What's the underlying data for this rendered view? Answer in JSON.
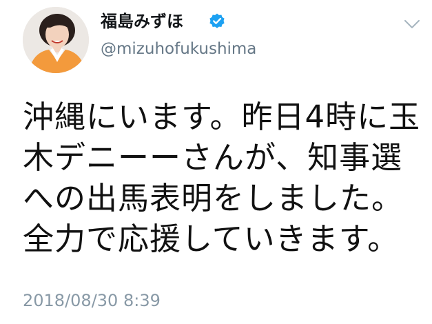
{
  "user": {
    "display_name": "福島みずほ",
    "handle": "@mizuhofukushima",
    "verified": true,
    "verified_color": "#1da1f2"
  },
  "tweet": {
    "lines": [
      "沖縄にいます。昨日4時に玉",
      "木デニーーさんが、知事選",
      "への出馬表明をしました。",
      "全力で応援していきます。"
    ],
    "timestamp": "2018/08/30 8:39"
  },
  "icons": {
    "verified": "verified-badge-icon",
    "caret": "chevron-down-icon"
  },
  "colors": {
    "name": "#14171a",
    "handle": "#657786",
    "timestamp": "#8899a6",
    "avatar_jacket": "#f39a3c"
  }
}
